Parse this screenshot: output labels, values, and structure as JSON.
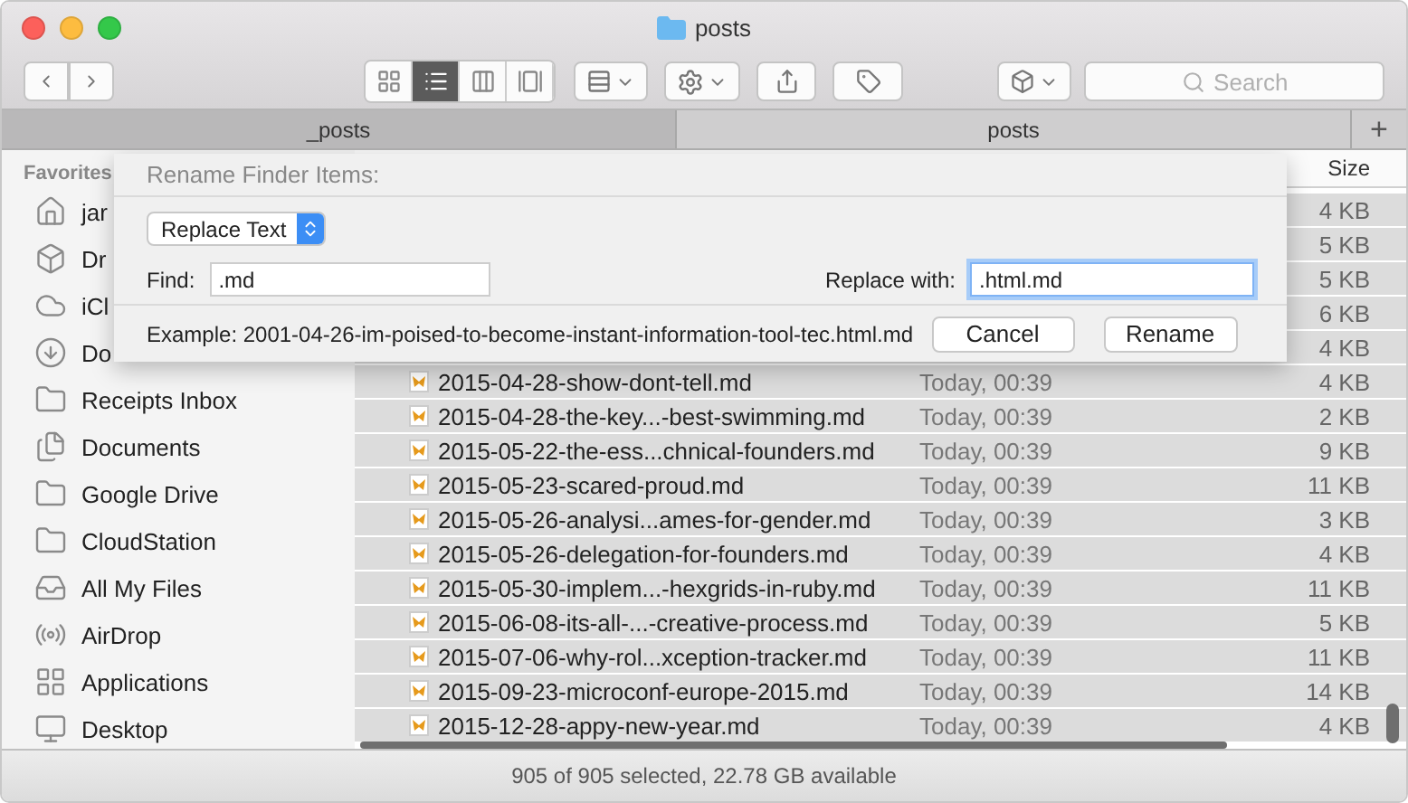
{
  "window": {
    "title": "posts"
  },
  "toolbar": {
    "search": {
      "placeholder": "Search"
    },
    "view_modes": [
      {
        "kind": "icons",
        "selected": false
      },
      {
        "kind": "list",
        "selected": true
      },
      {
        "kind": "columns",
        "selected": false
      },
      {
        "kind": "coverflow",
        "selected": false
      }
    ]
  },
  "tabs": [
    {
      "label": "_posts",
      "selected": false
    },
    {
      "label": "posts",
      "selected": true
    }
  ],
  "tab_add": "+",
  "sidebar": {
    "heading": "Favorites",
    "items": [
      {
        "kind": "home",
        "label": "jar"
      },
      {
        "kind": "dropbox",
        "label": "Dr"
      },
      {
        "kind": "cloud",
        "label": "iCl"
      },
      {
        "kind": "download",
        "label": "Do"
      },
      {
        "kind": "folder",
        "label": "Receipts Inbox"
      },
      {
        "kind": "documents",
        "label": "Documents"
      },
      {
        "kind": "folder",
        "label": "Google Drive"
      },
      {
        "kind": "folder",
        "label": "CloudStation"
      },
      {
        "kind": "files",
        "label": "All My Files"
      },
      {
        "kind": "airdrop",
        "label": "AirDrop"
      },
      {
        "kind": "applications",
        "label": "Applications"
      },
      {
        "kind": "desktop",
        "label": "Desktop"
      }
    ]
  },
  "table": {
    "columns": {
      "size": "Size"
    },
    "rows": [
      {
        "size": "4 KB",
        "selected": true
      },
      {
        "size": "5 KB",
        "selected": true
      },
      {
        "size": "5 KB",
        "selected": true
      },
      {
        "size": "6 KB",
        "selected": true
      },
      {
        "size": "4 KB",
        "selected": true
      },
      {
        "name": "2015-04-28-show-dont-tell.md",
        "date": "Today, 00:39",
        "size": "4 KB",
        "selected": true
      },
      {
        "name": "2015-04-28-the-key...-best-swimming.md",
        "date": "Today, 00:39",
        "size": "2 KB",
        "selected": true
      },
      {
        "name": "2015-05-22-the-ess...chnical-founders.md",
        "date": "Today, 00:39",
        "size": "9 KB",
        "selected": true
      },
      {
        "name": "2015-05-23-scared-proud.md",
        "date": "Today, 00:39",
        "size": "11 KB",
        "selected": true
      },
      {
        "name": "2015-05-26-analysi...ames-for-gender.md",
        "date": "Today, 00:39",
        "size": "3 KB",
        "selected": true
      },
      {
        "name": "2015-05-26-delegation-for-founders.md",
        "date": "Today, 00:39",
        "size": "4 KB",
        "selected": true
      },
      {
        "name": "2015-05-30-implem...-hexgrids-in-ruby.md",
        "date": "Today, 00:39",
        "size": "11 KB",
        "selected": true
      },
      {
        "name": "2015-06-08-its-all-...-creative-process.md",
        "date": "Today, 00:39",
        "size": "5 KB",
        "selected": true
      },
      {
        "name": "2015-07-06-why-rol...xception-tracker.md",
        "date": "Today, 00:39",
        "size": "11 KB",
        "selected": true
      },
      {
        "name": "2015-09-23-microconf-europe-2015.md",
        "date": "Today, 00:39",
        "size": "14 KB",
        "selected": true
      },
      {
        "name": "2015-12-28-appy-new-year.md",
        "date": "Today, 00:39",
        "size": "4 KB",
        "selected": true
      }
    ]
  },
  "dialog": {
    "title": "Rename Finder Items:",
    "mode": "Replace Text",
    "find_label": "Find:",
    "find_value": ".md",
    "replace_label": "Replace with:",
    "replace_value": ".html.md",
    "example": "Example: 2001-04-26-im-poised-to-become-instant-information-tool-tec.html.md",
    "buttons": [
      "Cancel",
      "Rename"
    ]
  },
  "status_bar": "905 of 905 selected, 22.78 GB available"
}
